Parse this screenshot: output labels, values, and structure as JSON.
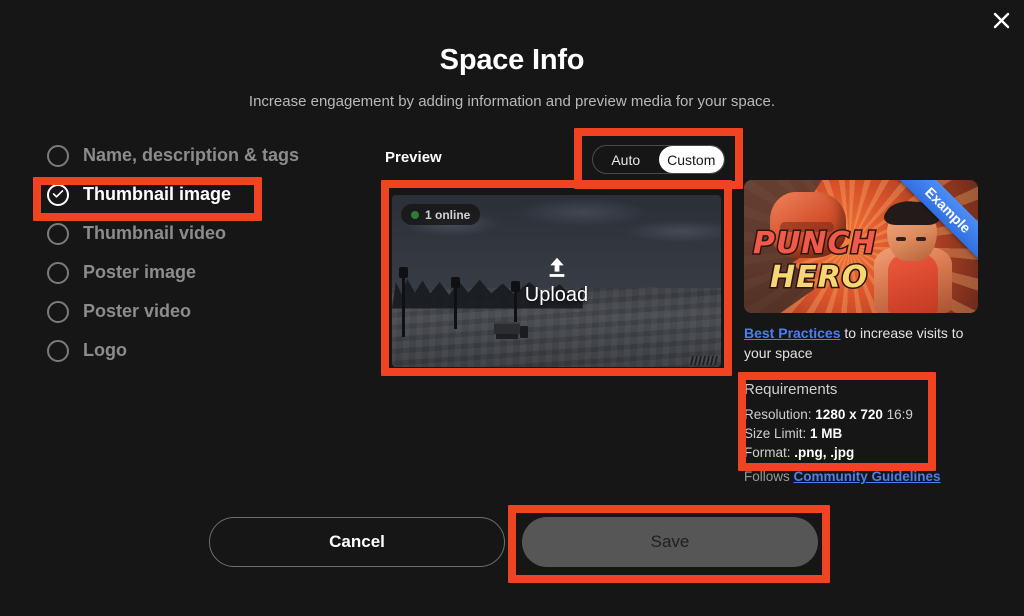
{
  "header": {
    "title": "Space Info",
    "subtitle": "Increase engagement by adding information and preview media for your space.",
    "close_icon": "close-icon"
  },
  "sidebar": {
    "items": [
      {
        "label": "Name, description & tags",
        "selected": false
      },
      {
        "label": "Thumbnail image",
        "selected": true
      },
      {
        "label": "Thumbnail video",
        "selected": false
      },
      {
        "label": "Poster image",
        "selected": false
      },
      {
        "label": "Poster video",
        "selected": false
      },
      {
        "label": "Logo",
        "selected": false
      }
    ]
  },
  "preview": {
    "label": "Preview",
    "toggle": {
      "auto": "Auto",
      "custom": "Custom",
      "selected": "Custom"
    },
    "online_badge": "1 online",
    "upload_label": "Upload",
    "upload_icon": "upload-arrow-icon"
  },
  "example": {
    "ribbon": "Example",
    "game_title_line1": "PUNCH",
    "game_title_line2": "HERO",
    "best_practices_link": "Best Practices",
    "best_practices_rest": " to increase visits to your space"
  },
  "requirements": {
    "heading": "Requirements",
    "resolution_label": "Resolution: ",
    "resolution_value": "1280 x 720",
    "resolution_ratio": " 16:9",
    "size_label": "Size Limit: ",
    "size_value": "1 MB",
    "format_label": "Format: ",
    "format_value": ".png, .jpg",
    "follows_prefix": "Follows ",
    "follows_link": "Community Guidelines"
  },
  "footer": {
    "cancel": "Cancel",
    "save": "Save"
  },
  "colors": {
    "annotation": "#f04322",
    "link": "#4c7ef3",
    "online_dot": "#2e7d32",
    "background": "#161616"
  }
}
